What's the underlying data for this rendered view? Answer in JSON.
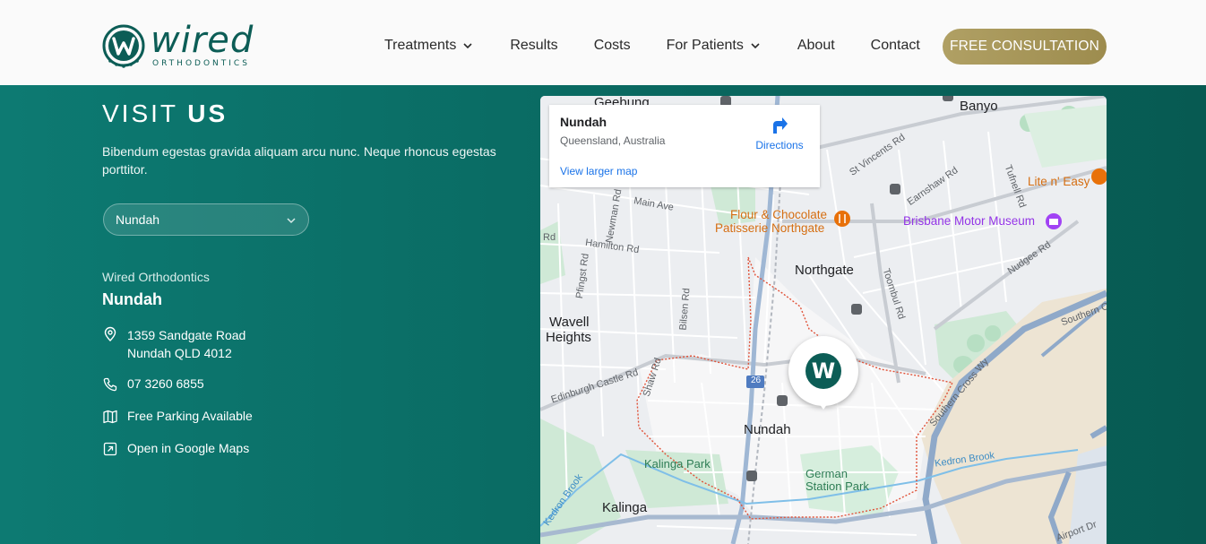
{
  "brand": {
    "name": "wired",
    "tagline": "ORTHODONTICS",
    "mark_letter": "W",
    "primary_color": "#0c5d56",
    "gold_color": "#a99a5b"
  },
  "nav": {
    "items": [
      {
        "label": "Treatments",
        "has_dropdown": true
      },
      {
        "label": "Results",
        "has_dropdown": false
      },
      {
        "label": "Costs",
        "has_dropdown": false
      },
      {
        "label": "For Patients",
        "has_dropdown": true
      },
      {
        "label": "About",
        "has_dropdown": false
      },
      {
        "label": "Contact",
        "has_dropdown": false
      }
    ],
    "cta_label": "FREE CONSULTATION"
  },
  "visit": {
    "title_light": "VISIT",
    "title_bold": "US",
    "lead": "Bibendum egestas gravida aliquam arcu nunc. Neque rhoncus egestas porttitor.",
    "location_select": "Nundah",
    "brand_label": "Wired Orthodontics",
    "location_name": "Nundah",
    "address_line1": "1359 Sandgate Road",
    "address_line2": "Nundah QLD 4012",
    "phone": "07 3260 6855",
    "parking": "Free Parking Available",
    "maps_link": "Open in Google Maps"
  },
  "map": {
    "card": {
      "title": "Nundah",
      "subtitle": "Queensland, Australia",
      "directions": "Directions",
      "larger_map": "View larger map"
    },
    "labels": {
      "geebung": "Geebung",
      "banyo": "Banyo",
      "st_vincents": "St Vincents Rd",
      "earnshaw": "Earnshaw Rd",
      "tufnell": "Tufnell Rd",
      "lite_n_easy": "Lite n' Easy",
      "main_ave": "Main Ave",
      "newman": "Newman Rd",
      "flour_1": "Flour & Chocolate",
      "flour_2": "Patisserie Northgate",
      "motor_museum": "Brisbane Motor Museum",
      "rd_left": "Rd",
      "hamilton": "Hamilton Rd",
      "nudgee": "Nudgee Rd",
      "northgate": "Northgate",
      "pfingst": "Pfingst Rd",
      "bilsen": "Bilsen Rd",
      "toombul": "Toombul Rd",
      "southern_top": "Southern C",
      "wavell_1": "Wavell",
      "wavell_2": "Heights",
      "edinburgh": "Edinburgh Castle Rd",
      "shaw": "Shaw Rd",
      "route_26": "26",
      "southern_cross": "Southern Cross Wy",
      "nundah": "Nundah",
      "kedron_brook_r": "Kedron Brook",
      "kalinga_park": "Kalinga Park",
      "german_1": "German",
      "german_2": "Station Park",
      "kedron_brook_l": "Kedron Brook",
      "kalinga": "Kalinga",
      "airport": "Airport Dr"
    }
  }
}
